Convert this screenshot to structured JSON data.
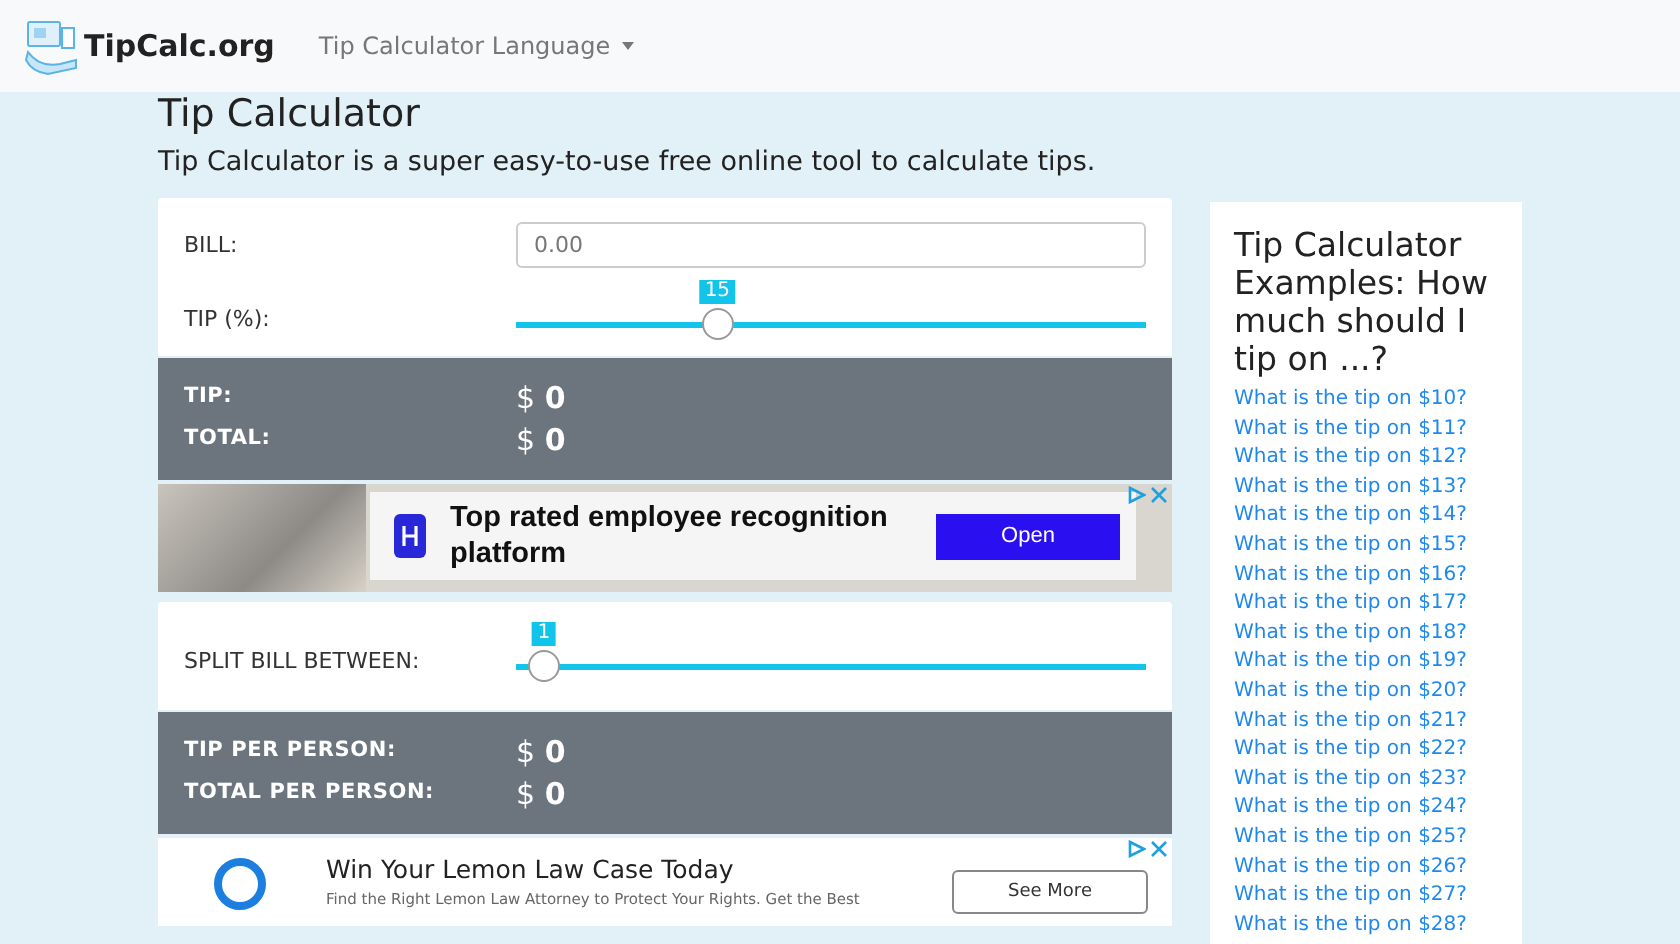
{
  "navbar": {
    "brand": "TipCalc.org",
    "language_menu": "Tip Calculator Language"
  },
  "header": {
    "title": "Tip Calculator",
    "subtitle": "Tip Calculator is a super easy-to-use free online tool to calculate tips."
  },
  "calculator": {
    "bill": {
      "label": "BILL:",
      "placeholder": "0.00"
    },
    "tip": {
      "label": "TIP (%):",
      "reading": "15",
      "level": 0.31
    },
    "results": [
      {
        "label": "TIP:",
        "currency": "$",
        "value": "0"
      },
      {
        "label": "TOTAL:",
        "currency": "$",
        "value": "0"
      }
    ],
    "ad": {
      "headline": "Top rated employee recognition platform",
      "button": "Open"
    },
    "split": {
      "label": "SPLIT BILL BETWEEN:",
      "reading": "1",
      "level": 0.02
    },
    "per_person": [
      {
        "label": "TIP PER PERSON:",
        "currency": "$",
        "value": "0"
      },
      {
        "label": "TOTAL PER PERSON:",
        "currency": "$",
        "value": "0"
      }
    ],
    "ad_2": {
      "headline": "Win Your Lemon Law Case Today",
      "description": "Find the Right Lemon Law Attorney to Protect Your Rights. Get the Best",
      "button": "See More"
    }
  },
  "sidebar": {
    "title": "Tip Calculator Examples: How much should I tip on ...?",
    "links": [
      "What is the tip on $10?",
      "What is the tip on $11?",
      "What is the tip on $12?",
      "What is the tip on $13?",
      "What is the tip on $14?",
      "What is the tip on $15?",
      "What is the tip on $16?",
      "What is the tip on $17?",
      "What is the tip on $18?",
      "What is the tip on $19?",
      "What is the tip on $20?",
      "What is the tip on $21?",
      "What is the tip on $22?",
      "What is the tip on $23?",
      "What is the tip on $24?",
      "What is the tip on $25?",
      "What is the tip on $26?",
      "What is the tip on $27?",
      "What is the tip on $28?"
    ]
  }
}
